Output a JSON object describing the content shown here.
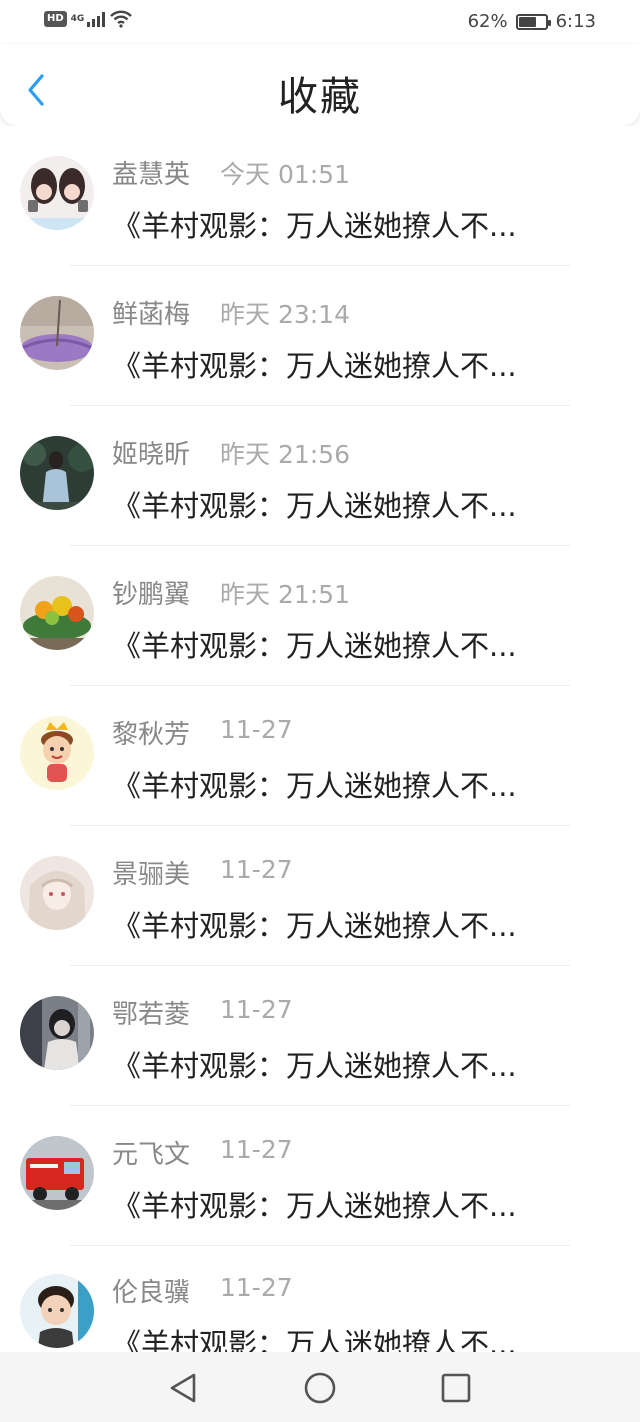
{
  "status_bar": {
    "hd": "HD",
    "network": "4G",
    "battery_text": "62%",
    "battery_level": 0.62,
    "time": "6:13"
  },
  "header": {
    "title": "收藏",
    "back_icon": "chevron-left-icon",
    "accent_color": "#2a9df4"
  },
  "items": [
    {
      "name": "盍慧英",
      "time": "今天 01:51",
      "title": "《羊村观影：万人迷她撩人不..."
    },
    {
      "name": "鲜菡梅",
      "time": "昨天 23:14",
      "title": "《羊村观影：万人迷她撩人不..."
    },
    {
      "name": "姬晓昕",
      "time": "昨天 21:56",
      "title": "《羊村观影：万人迷她撩人不..."
    },
    {
      "name": "钞鹏翼",
      "time": "昨天 21:51",
      "title": "《羊村观影：万人迷她撩人不..."
    },
    {
      "name": "黎秋芳",
      "time": "11-27",
      "title": "《羊村观影：万人迷她撩人不..."
    },
    {
      "name": "景骊美",
      "time": "11-27",
      "title": "《羊村观影：万人迷她撩人不..."
    },
    {
      "name": "鄂若菱",
      "time": "11-27",
      "title": "《羊村观影：万人迷她撩人不..."
    },
    {
      "name": "元飞文",
      "time": "11-27",
      "title": "《羊村观影：万人迷她撩人不..."
    },
    {
      "name": "伦良骥",
      "time": "11-27",
      "title": "《羊村观影：万人迷她撩人不..."
    }
  ],
  "bottom_nav": {
    "icons": [
      "back-triangle-icon",
      "home-circle-icon",
      "recents-square-icon"
    ]
  }
}
